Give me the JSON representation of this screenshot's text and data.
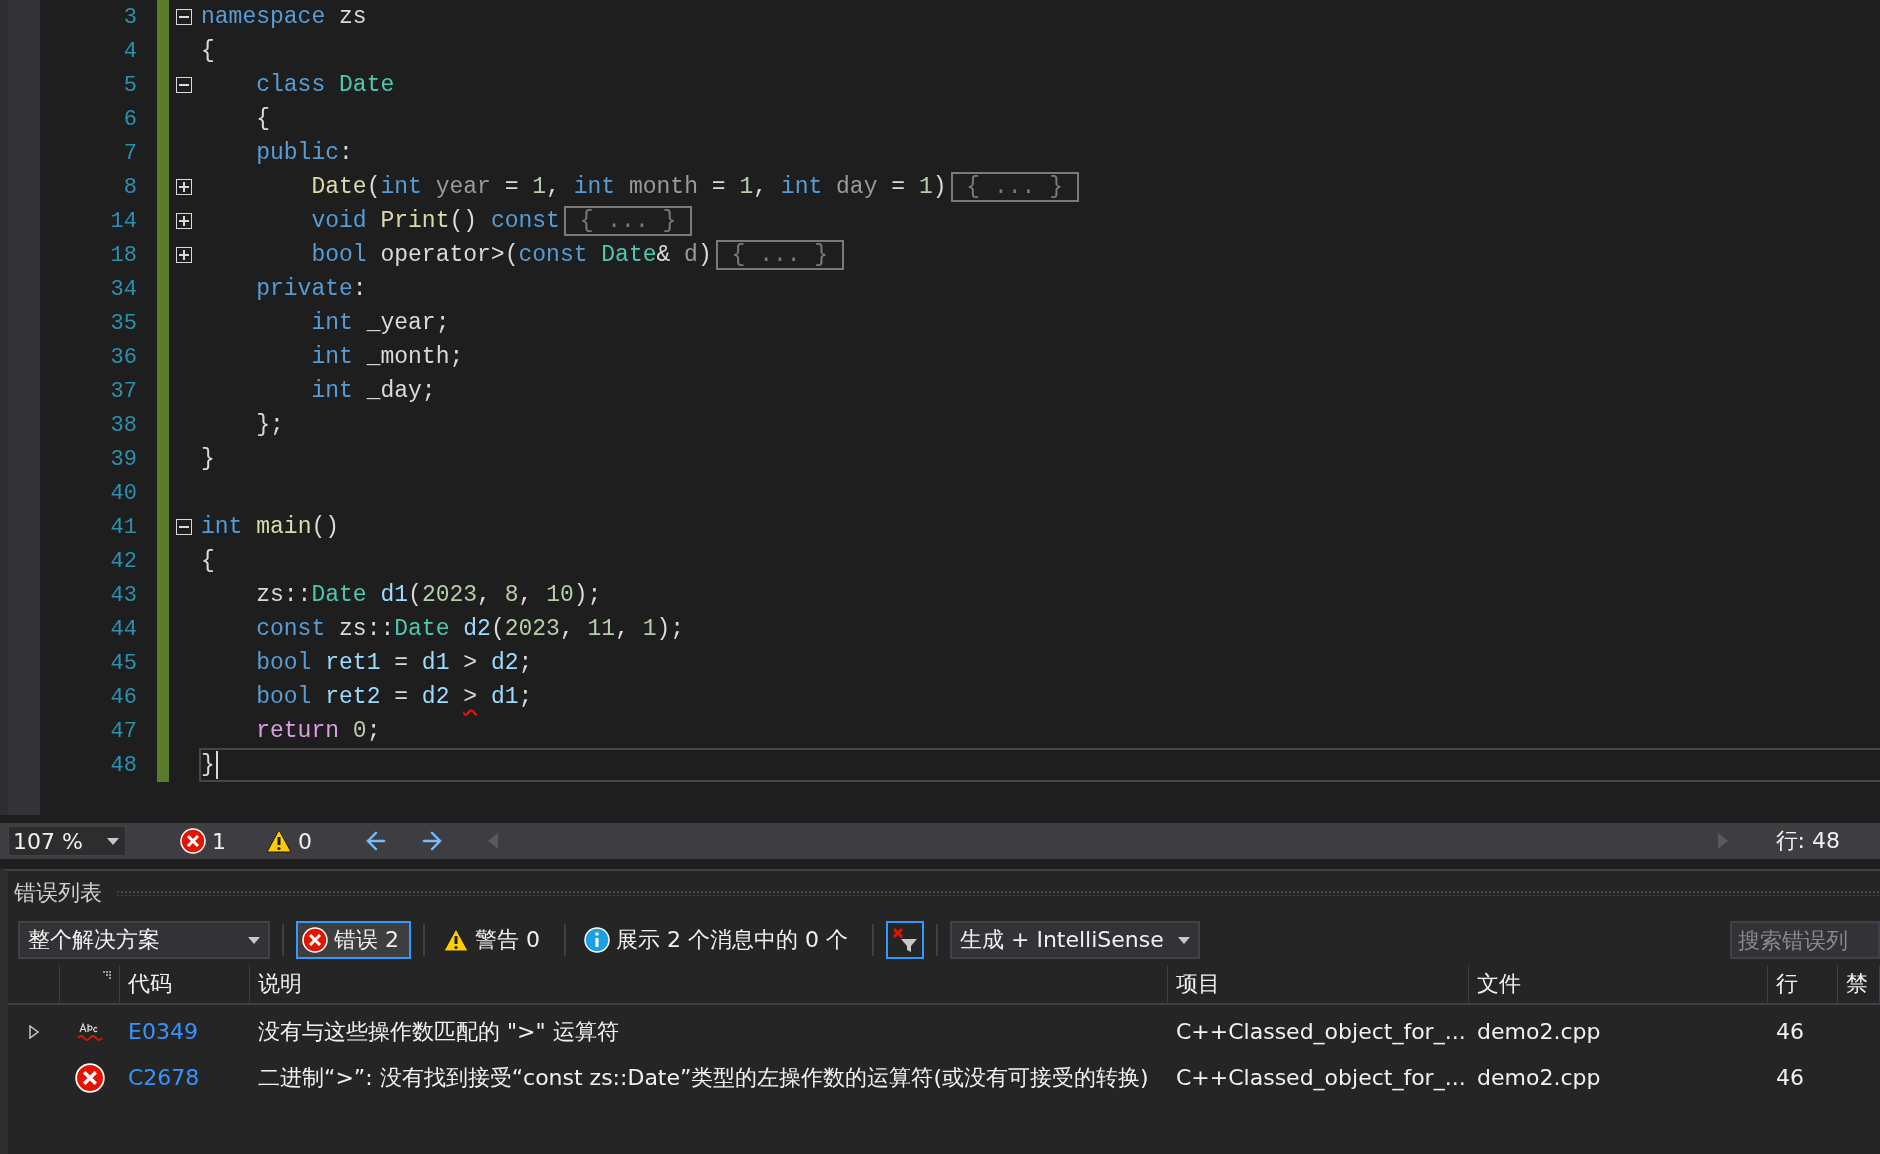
{
  "editor": {
    "lines": [
      {
        "number": "3",
        "collapsed": false,
        "tokens": [
          {
            "kind": "kw",
            "text": "namespace"
          },
          {
            "kind": "plain",
            "text": " zs"
          }
        ]
      },
      {
        "number": "4",
        "tokens": [
          {
            "kind": "plain",
            "text": "{"
          }
        ]
      },
      {
        "number": "5",
        "collapsed": false,
        "tokens": [
          {
            "kind": "kw",
            "text": "    class"
          },
          {
            "kind": "type",
            "text": " Date"
          }
        ]
      },
      {
        "number": "6",
        "tokens": [
          {
            "kind": "plain",
            "text": "    {"
          }
        ]
      },
      {
        "number": "7",
        "tokens": [
          {
            "kind": "kw",
            "text": "    public"
          },
          {
            "kind": "plain",
            "text": ":"
          }
        ]
      },
      {
        "number": "8",
        "collapsed": true,
        "tokens": [
          {
            "kind": "fn",
            "text": "        Date"
          },
          {
            "kind": "plain",
            "text": "("
          },
          {
            "kind": "kw",
            "text": "int"
          },
          {
            "kind": "param",
            "text": " year"
          },
          {
            "kind": "plain",
            "text": " = "
          },
          {
            "kind": "num",
            "text": "1"
          },
          {
            "kind": "plain",
            "text": ", "
          },
          {
            "kind": "kw",
            "text": "int"
          },
          {
            "kind": "param",
            "text": " month"
          },
          {
            "kind": "plain",
            "text": " = "
          },
          {
            "kind": "num",
            "text": "1"
          },
          {
            "kind": "plain",
            "text": ", "
          },
          {
            "kind": "kw",
            "text": "int"
          },
          {
            "kind": "param",
            "text": " day"
          },
          {
            "kind": "plain",
            "text": " = "
          },
          {
            "kind": "num",
            "text": "1"
          },
          {
            "kind": "plain",
            "text": ")"
          },
          {
            "kind": "collapsed",
            "text": " { ... } "
          }
        ]
      },
      {
        "number": "14",
        "collapsed": true,
        "tokens": [
          {
            "kind": "kw",
            "text": "        void"
          },
          {
            "kind": "fn",
            "text": " Print"
          },
          {
            "kind": "plain",
            "text": "() "
          },
          {
            "kind": "kw",
            "text": "const"
          },
          {
            "kind": "collapsed",
            "text": " { ... } "
          }
        ]
      },
      {
        "number": "18",
        "collapsed": true,
        "tokens": [
          {
            "kind": "kw",
            "text": "        bool"
          },
          {
            "kind": "plain",
            "text": " operator>("
          },
          {
            "kind": "kw",
            "text": "const"
          },
          {
            "kind": "type",
            "text": " Date"
          },
          {
            "kind": "plain",
            "text": "&"
          },
          {
            "kind": "param",
            "text": " d"
          },
          {
            "kind": "plain",
            "text": ")"
          },
          {
            "kind": "collapsed",
            "text": " { ... } "
          }
        ]
      },
      {
        "number": "34",
        "tokens": [
          {
            "kind": "kw",
            "text": "    private"
          },
          {
            "kind": "plain",
            "text": ":"
          }
        ]
      },
      {
        "number": "35",
        "tokens": [
          {
            "kind": "kw",
            "text": "        int"
          },
          {
            "kind": "plain",
            "text": " _year;"
          }
        ]
      },
      {
        "number": "36",
        "tokens": [
          {
            "kind": "kw",
            "text": "        int"
          },
          {
            "kind": "plain",
            "text": " _month;"
          }
        ]
      },
      {
        "number": "37",
        "tokens": [
          {
            "kind": "kw",
            "text": "        int"
          },
          {
            "kind": "plain",
            "text": " _day;"
          }
        ]
      },
      {
        "number": "38",
        "tokens": [
          {
            "kind": "plain",
            "text": "    };"
          }
        ]
      },
      {
        "number": "39",
        "tokens": [
          {
            "kind": "plain",
            "text": "}"
          }
        ]
      },
      {
        "number": "40"
      },
      {
        "number": "41",
        "collapsed": false,
        "tokens": [
          {
            "kind": "kw",
            "text": "int"
          },
          {
            "kind": "fn",
            "text": " main"
          },
          {
            "kind": "plain",
            "text": "()"
          }
        ]
      },
      {
        "number": "42",
        "tokens": [
          {
            "kind": "plain",
            "text": "{"
          }
        ]
      },
      {
        "number": "43",
        "tokens": [
          {
            "kind": "plain",
            "text": "    zs::"
          },
          {
            "kind": "type",
            "text": "Date"
          },
          {
            "kind": "var",
            "text": " d1"
          },
          {
            "kind": "plain",
            "text": "("
          },
          {
            "kind": "num",
            "text": "2023"
          },
          {
            "kind": "plain",
            "text": ", "
          },
          {
            "kind": "num",
            "text": "8"
          },
          {
            "kind": "plain",
            "text": ", "
          },
          {
            "kind": "num",
            "text": "10"
          },
          {
            "kind": "plain",
            "text": ");"
          }
        ]
      },
      {
        "number": "44",
        "tokens": [
          {
            "kind": "kw",
            "text": "    const"
          },
          {
            "kind": "plain",
            "text": " zs::"
          },
          {
            "kind": "type",
            "text": "Date"
          },
          {
            "kind": "var",
            "text": " d2"
          },
          {
            "kind": "plain",
            "text": "("
          },
          {
            "kind": "num",
            "text": "2023"
          },
          {
            "kind": "plain",
            "text": ", "
          },
          {
            "kind": "num",
            "text": "11"
          },
          {
            "kind": "plain",
            "text": ", "
          },
          {
            "kind": "num",
            "text": "1"
          },
          {
            "kind": "plain",
            "text": ");"
          }
        ]
      },
      {
        "number": "45",
        "tokens": [
          {
            "kind": "kw",
            "text": "    bool"
          },
          {
            "kind": "var",
            "text": " ret1"
          },
          {
            "kind": "plain",
            "text": " = "
          },
          {
            "kind": "var",
            "text": "d1"
          },
          {
            "kind": "plain",
            "text": " > "
          },
          {
            "kind": "var",
            "text": "d2"
          },
          {
            "kind": "plain",
            "text": ";"
          }
        ]
      },
      {
        "number": "46",
        "tokens": [
          {
            "kind": "kw",
            "text": "    bool"
          },
          {
            "kind": "var",
            "text": " ret2"
          },
          {
            "kind": "plain",
            "text": " = "
          },
          {
            "kind": "var",
            "text": "d2 "
          },
          {
            "kind": "error",
            "text": ">"
          },
          {
            "kind": "var",
            "text": " d1"
          },
          {
            "kind": "plain",
            "text": ";"
          }
        ]
      },
      {
        "number": "47",
        "tokens": [
          {
            "kind": "ctl",
            "text": "    return"
          },
          {
            "kind": "num",
            "text": " 0"
          },
          {
            "kind": "plain",
            "text": ";"
          }
        ]
      },
      {
        "number": "48",
        "current": true,
        "tokens": [
          {
            "kind": "plain",
            "text": "}"
          }
        ]
      }
    ]
  },
  "status_bar": {
    "zoom": "107 %",
    "errors": "1",
    "warnings": "0",
    "position": "行: 48"
  },
  "error_list": {
    "title": "错误列表",
    "scope": "整个解决方案",
    "filters": [
      {
        "kind": "error",
        "label": "错误 2",
        "selected": true
      },
      {
        "kind": "warning",
        "label": "警告 0",
        "selected": false
      },
      {
        "kind": "info",
        "label": "展示 2 个消息中的 0 个",
        "selected": false
      }
    ],
    "clear_filter_selected": true,
    "source": "生成 + IntelliSense",
    "search": {
      "placeholder": "搜索错误列"
    },
    "columns": [
      "代码",
      "说明",
      "项目",
      "文件",
      "行",
      "禁"
    ],
    "rows": [
      {
        "kind": "intellisense",
        "expanded": false,
        "code": "E0349",
        "description": "没有与这些操作数匹配的 \">\" 运算符",
        "project": "C++Classed_object_for_...",
        "file": "demo2.cpp",
        "line": "46"
      },
      {
        "kind": "build",
        "code": "C2678",
        "description": "二进制“>”: 没有找到接受“const zs::Date”类型的左操作数的运算符(或没有可接受的转换)",
        "project": "C++Classed_object_for_...",
        "file": "demo2.cpp",
        "line": "46"
      }
    ]
  }
}
